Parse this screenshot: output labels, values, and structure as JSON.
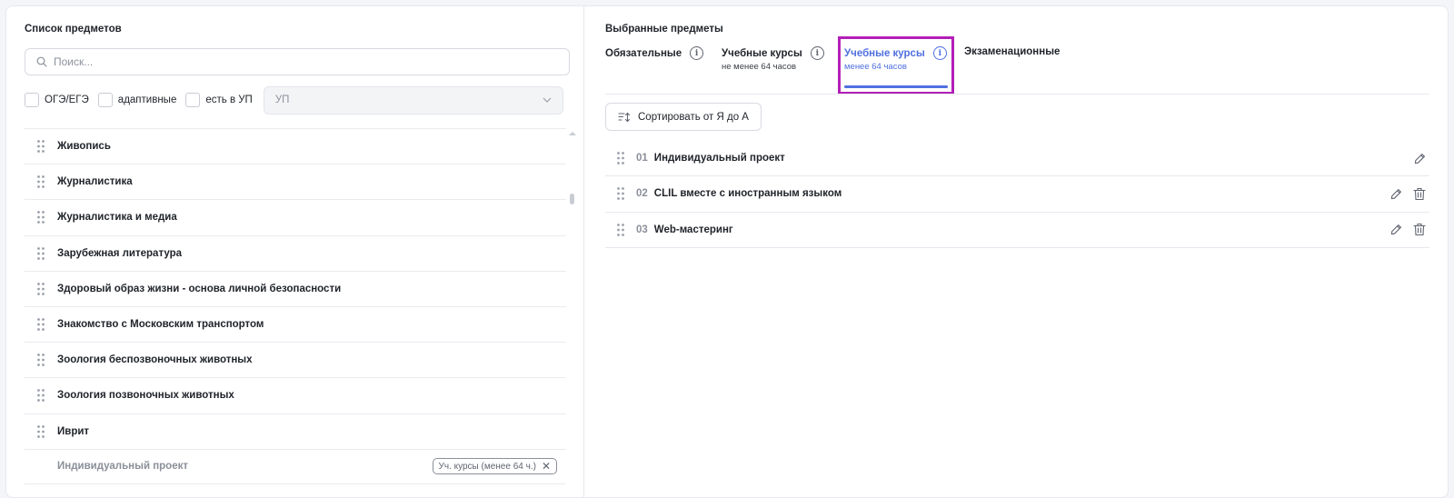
{
  "left_panel": {
    "title": "Список предметов",
    "search_placeholder": "Поиск...",
    "filters": [
      {
        "label": "ОГЭ/ЕГЭ",
        "checked": false
      },
      {
        "label": "адаптивные",
        "checked": false
      },
      {
        "label": "есть в УП",
        "checked": false
      }
    ],
    "select_value": "УП",
    "items": [
      {
        "name": "Живопись"
      },
      {
        "name": "Журналистика"
      },
      {
        "name": "Журналистика и медиа"
      },
      {
        "name": "Зарубежная литература"
      },
      {
        "name": "Здоровый образ жизни - основа личной безопасности"
      },
      {
        "name": "Знакомство с Московским транспортом"
      },
      {
        "name": "Зоология беспозвоночных животных"
      },
      {
        "name": "Зоология позвоночных животных"
      },
      {
        "name": "Иврит"
      }
    ],
    "disabled_item": {
      "name": "Индивидуальный проект",
      "tag": "Уч. курсы (менее 64 ч.)"
    }
  },
  "right_panel": {
    "title": "Выбранные предметы",
    "tabs": [
      {
        "title": "Обязательные",
        "subtitle": "",
        "info": "i",
        "active": false
      },
      {
        "title": "Учебные курсы",
        "subtitle": "не менее 64 часов",
        "info": "i",
        "active": false
      },
      {
        "title": "Учебные курсы",
        "subtitle": "менее 64 часов",
        "info": "i",
        "active": true
      },
      {
        "title": "Экзаменационные",
        "subtitle": "",
        "active": false
      }
    ],
    "sort_label": "Сортировать от Я до А",
    "selected": [
      {
        "num": "01",
        "name": "Индивидуальный проект",
        "editable": true,
        "deletable": false
      },
      {
        "num": "02",
        "name": "CLIL вместе с иностранным языком",
        "editable": true,
        "deletable": true
      },
      {
        "num": "03",
        "name": "Web-мастеринг",
        "editable": true,
        "deletable": true
      }
    ]
  },
  "colors": {
    "accent": "#4f6fe0",
    "highlight": "#b31fb7",
    "muted": "#8a8f99"
  }
}
